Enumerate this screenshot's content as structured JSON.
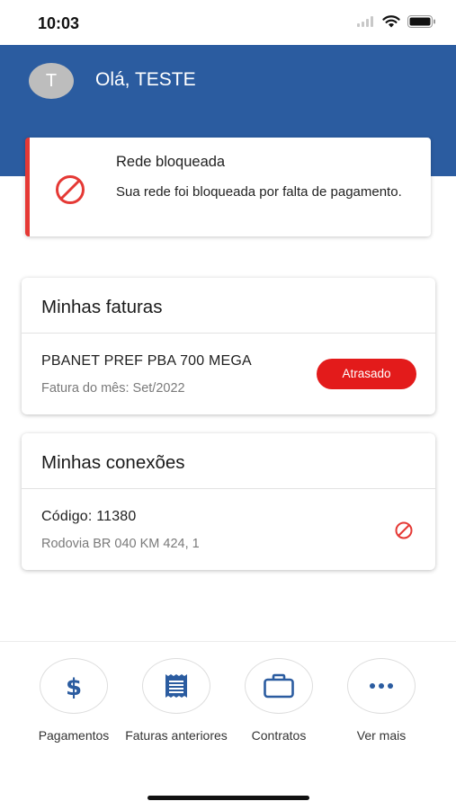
{
  "status_bar": {
    "time": "10:03"
  },
  "header": {
    "avatar_initial": "T",
    "greeting": "Olá, TESTE",
    "background": "#2b5ca0"
  },
  "alert": {
    "title": "Rede bloqueada",
    "message": "Sua rede foi bloqueada por falta de pagamento.",
    "icon": "blocked-icon",
    "accent": "#e53935"
  },
  "invoices": {
    "title": "Minhas faturas",
    "items": [
      {
        "plan": "PBANET PREF PBA 700 MEGA",
        "period": "Fatura do mês: Set/2022",
        "status": "Atrasado"
      }
    ]
  },
  "connections": {
    "title": "Minhas conexões",
    "items": [
      {
        "code": "Código:  11380",
        "address": "Rodovia BR 040 KM 424, 1",
        "icon": "blocked-icon"
      }
    ]
  },
  "bottom_nav": {
    "items": [
      {
        "label": "Pagamentos",
        "icon": "dollar-icon"
      },
      {
        "label": "Faturas anteriores",
        "icon": "receipt-icon"
      },
      {
        "label": "Contratos",
        "icon": "briefcase-icon"
      },
      {
        "label": "Ver mais",
        "icon": "more-icon"
      }
    ]
  },
  "colors": {
    "primary": "#2b5ca0",
    "danger": "#e31b1b"
  }
}
